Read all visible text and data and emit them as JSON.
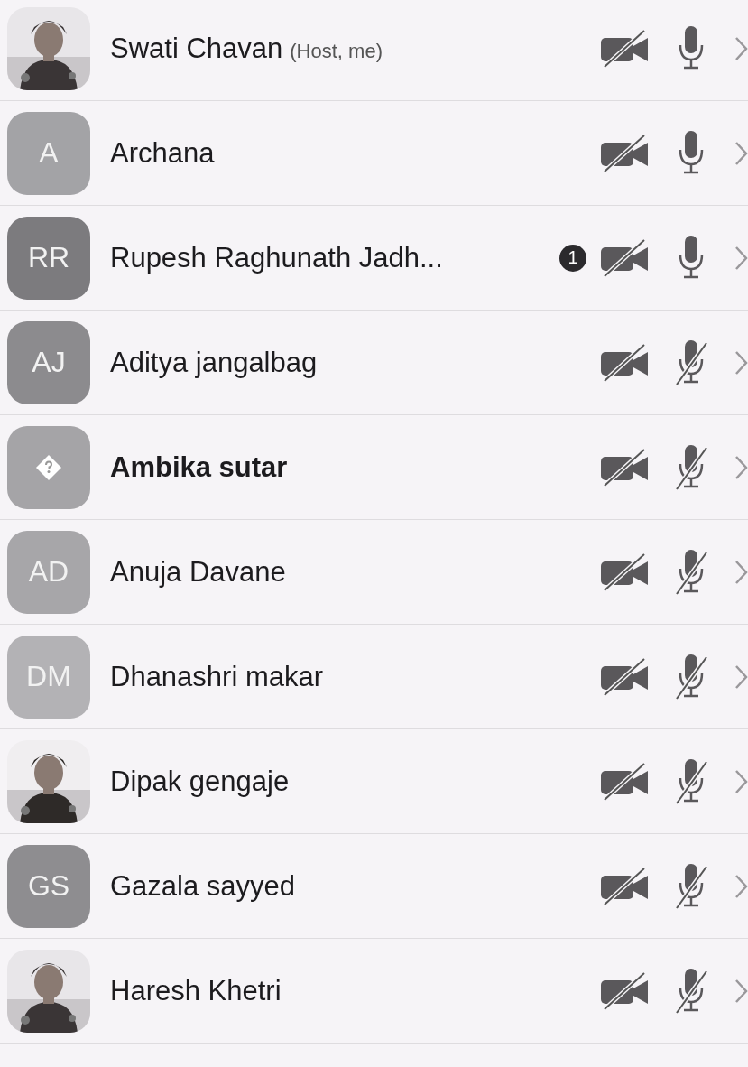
{
  "participants": [
    {
      "name": "Swati Chavan",
      "role": "(Host, me)",
      "bold": false,
      "video_off": true,
      "mic_muted": false
    },
    {
      "avatar": {
        "kind": "initials",
        "text": "A",
        "color": "#a3a3a6"
      },
      "name": "Archana",
      "bold": false,
      "video_off": true,
      "mic_muted": false
    },
    {
      "avatar": {
        "kind": "initials",
        "text": "RR",
        "color": "#7c7b7e"
      },
      "name": "Rupesh Raghunath Jadh...",
      "badge": "1",
      "bold": false,
      "video_off": true,
      "mic_muted": false
    },
    {
      "avatar": {
        "kind": "initials",
        "text": "AJ",
        "color": "#8c8b8e"
      },
      "name": "Aditya jangalbag",
      "bold": false,
      "video_off": true,
      "mic_muted": true
    },
    {
      "avatar": {
        "kind": "unknown",
        "color": "#a5a4a7"
      },
      "name": "Ambika sutar",
      "bold": true,
      "video_off": true,
      "mic_muted": true
    },
    {
      "avatar": {
        "kind": "initials",
        "text": "AD",
        "color": "#a7a6a9"
      },
      "name": "Anuja Davane",
      "bold": false,
      "video_off": true,
      "mic_muted": true
    },
    {
      "avatar": {
        "kind": "initials",
        "text": "DM",
        "color": "#b3b2b5"
      },
      "name": "Dhanashri makar",
      "bold": false,
      "video_off": true,
      "mic_muted": true
    },
    {
      "name": "Dipak gengaje",
      "bold": false,
      "video_off": true,
      "mic_muted": true
    },
    {
      "avatar": {
        "kind": "initials",
        "text": "GS",
        "color": "#8e8d90"
      },
      "name": "Gazala sayyed",
      "bold": false,
      "video_off": true,
      "mic_muted": true
    },
    {
      "name": "Haresh Khetri",
      "bold": false,
      "video_off": true,
      "mic_muted": true
    }
  ]
}
